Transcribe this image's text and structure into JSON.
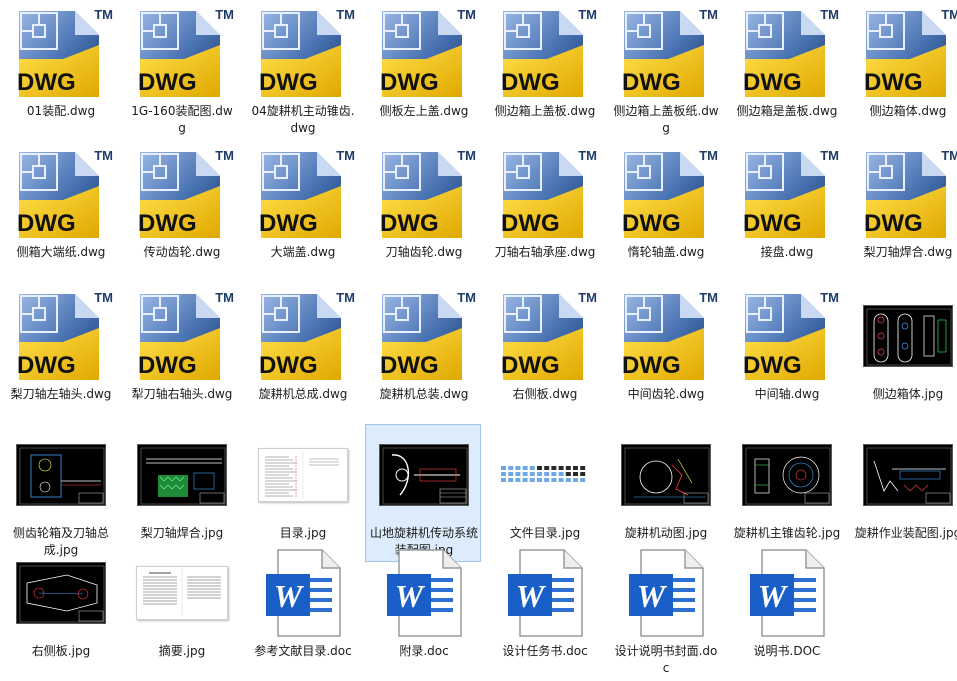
{
  "colors": {
    "dwg_blue_dark": "#1f3f73",
    "dwg_blue_light": "#7aa0d8",
    "dwg_yellow": "#f2c400",
    "word_blue": "#1a5fc8",
    "selection": "#dcecfc"
  },
  "files": [
    {
      "name": "01装配.dwg",
      "type": "dwg",
      "icon": "dwg-file-icon"
    },
    {
      "name": "1G-160装配图.dwg",
      "type": "dwg",
      "icon": "dwg-file-icon"
    },
    {
      "name": "04旋耕机主动锥齿.dwg",
      "type": "dwg",
      "icon": "dwg-file-icon"
    },
    {
      "name": "侧板左上盖.dwg",
      "type": "dwg",
      "icon": "dwg-file-icon"
    },
    {
      "name": "侧边箱上盖板.dwg",
      "type": "dwg",
      "icon": "dwg-file-icon"
    },
    {
      "name": "侧边箱上盖板纸.dwg",
      "type": "dwg",
      "icon": "dwg-file-icon"
    },
    {
      "name": "侧边箱是盖板.dwg",
      "type": "dwg",
      "icon": "dwg-file-icon"
    },
    {
      "name": "侧边箱体.dwg",
      "type": "dwg",
      "icon": "dwg-file-icon"
    },
    {
      "name": "侧箱大端纸.dwg",
      "type": "dwg",
      "icon": "dwg-file-icon"
    },
    {
      "name": "传动齿轮.dwg",
      "type": "dwg",
      "icon": "dwg-file-icon"
    },
    {
      "name": "大端盖.dwg",
      "type": "dwg",
      "icon": "dwg-file-icon"
    },
    {
      "name": "刀轴齿轮.dwg",
      "type": "dwg",
      "icon": "dwg-file-icon"
    },
    {
      "name": "刀轴右轴承座.dwg",
      "type": "dwg",
      "icon": "dwg-file-icon"
    },
    {
      "name": "惰轮轴盖.dwg",
      "type": "dwg",
      "icon": "dwg-file-icon"
    },
    {
      "name": "接盘.dwg",
      "type": "dwg",
      "icon": "dwg-file-icon"
    },
    {
      "name": "梨刀轴焊合.dwg",
      "type": "dwg",
      "icon": "dwg-file-icon"
    },
    {
      "name": "梨刀轴左轴头.dwg",
      "type": "dwg",
      "icon": "dwg-file-icon"
    },
    {
      "name": "犁刀轴右轴头.dwg",
      "type": "dwg",
      "icon": "dwg-file-icon"
    },
    {
      "name": "旋耕机总成.dwg",
      "type": "dwg",
      "icon": "dwg-file-icon"
    },
    {
      "name": "旋耕机总装.dwg",
      "type": "dwg",
      "icon": "dwg-file-icon"
    },
    {
      "name": "右侧板.dwg",
      "type": "dwg",
      "icon": "dwg-file-icon"
    },
    {
      "name": "中间齿轮.dwg",
      "type": "dwg",
      "icon": "dwg-file-icon"
    },
    {
      "name": "中间轴.dwg",
      "type": "dwg",
      "icon": "dwg-file-icon"
    },
    {
      "name": "侧边箱体.jpg",
      "type": "jpg",
      "icon": "chain-drawing-thumbnail"
    },
    {
      "name": "侧齿轮箱及刀轴总成.jpg",
      "type": "jpg",
      "icon": "gearbox-drawing-thumbnail"
    },
    {
      "name": "梨刀轴焊合.jpg",
      "type": "jpg",
      "icon": "shaft-drawing-thumbnail"
    },
    {
      "name": "目录.jpg",
      "type": "doc-jpg",
      "icon": "contents-page-thumbnail"
    },
    {
      "name": "山地旋耕机传动系统装配图.jpg",
      "type": "jpg",
      "icon": "assembly-drawing-thumbnail",
      "selected": true
    },
    {
      "name": "文件目录.jpg",
      "type": "list-jpg",
      "icon": "file-list-thumbnail"
    },
    {
      "name": "旋耕机动图.jpg",
      "type": "jpg",
      "icon": "motion-drawing-thumbnail"
    },
    {
      "name": "旋耕机主锥齿轮.jpg",
      "type": "jpg",
      "icon": "bevel-gear-drawing-thumbnail"
    },
    {
      "name": "旋耕作业装配图.jpg",
      "type": "jpg",
      "icon": "operation-assembly-thumbnail"
    },
    {
      "name": "右侧板.jpg",
      "type": "jpg",
      "icon": "side-plate-drawing-thumbnail"
    },
    {
      "name": "摘要.jpg",
      "type": "doc-jpg",
      "icon": "abstract-page-thumbnail"
    },
    {
      "name": "参考文献目录.doc",
      "type": "doc",
      "icon": "word-doc-icon"
    },
    {
      "name": "附录.doc",
      "type": "doc",
      "icon": "word-doc-icon"
    },
    {
      "name": "设计任务书.doc",
      "type": "doc",
      "icon": "word-doc-icon"
    },
    {
      "name": "设计说明书封面.doc",
      "type": "doc",
      "icon": "word-doc-icon"
    },
    {
      "name": "说明书.DOC",
      "type": "doc",
      "icon": "word-doc-icon"
    }
  ],
  "dwg_icon": {
    "badge": "TM",
    "text": "DWG"
  },
  "word_icon": {
    "letter": "W"
  }
}
